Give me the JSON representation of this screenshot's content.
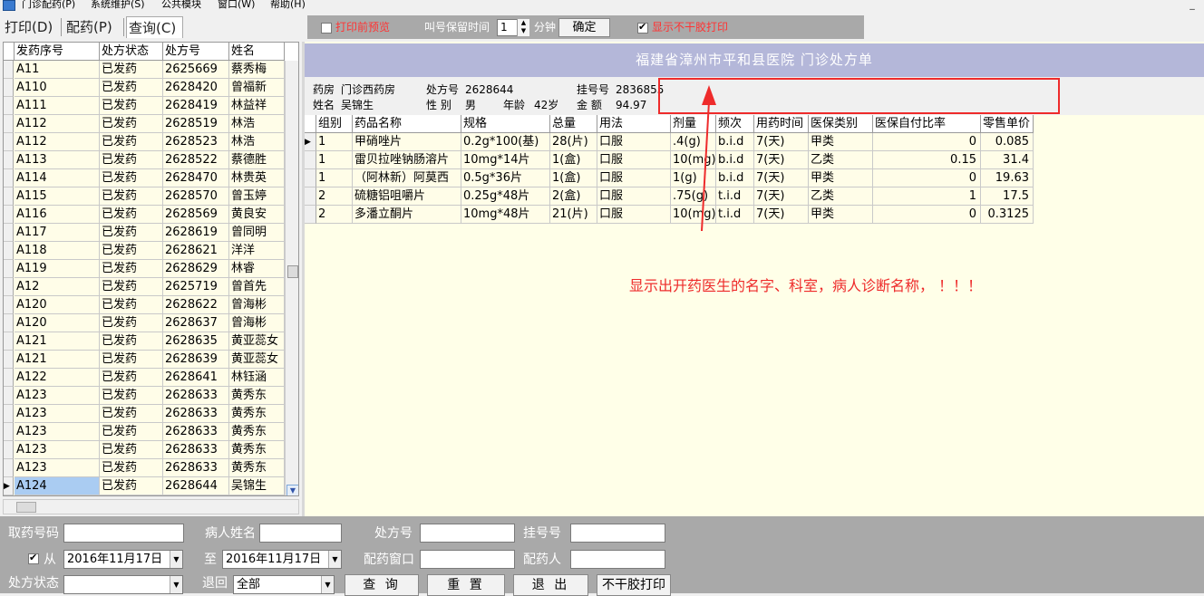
{
  "menubar": {
    "items": [
      "门诊配药(P)",
      "系统维护(S)",
      "公共模块",
      "窗口(W)",
      "帮助(H)"
    ],
    "min_glyph": "_"
  },
  "tabs": [
    {
      "label": "打印(D)",
      "active": false
    },
    {
      "label": "配药(P)",
      "active": false
    },
    {
      "label": "查询(C)",
      "active": true
    }
  ],
  "toolbar": {
    "preview_label": "打印前预览",
    "preview_checked": false,
    "hold_label": "叫号保留时间",
    "hold_value": "1",
    "minutes_label": "分钟",
    "ok_label": "确定",
    "no_dry_label": "显示不干胶打印",
    "no_dry_checked": true,
    "accent_color": "#ff3333"
  },
  "left_grid": {
    "headers": [
      "发药序号",
      "处方状态",
      "处方号",
      "姓名"
    ],
    "rows": [
      [
        "A11",
        "已发药",
        "2625669",
        "蔡秀梅"
      ],
      [
        "A110",
        "已发药",
        "2628420",
        "曾福新"
      ],
      [
        "A111",
        "已发药",
        "2628419",
        "林益祥"
      ],
      [
        "A112",
        "已发药",
        "2628519",
        "林浩"
      ],
      [
        "A112",
        "已发药",
        "2628523",
        "林浩"
      ],
      [
        "A113",
        "已发药",
        "2628522",
        "蔡德胜"
      ],
      [
        "A114",
        "已发药",
        "2628470",
        "林贵英"
      ],
      [
        "A115",
        "已发药",
        "2628570",
        "曾玉婷"
      ],
      [
        "A116",
        "已发药",
        "2628569",
        "黄良安"
      ],
      [
        "A117",
        "已发药",
        "2628619",
        "曾同明"
      ],
      [
        "A118",
        "已发药",
        "2628621",
        "洋洋"
      ],
      [
        "A119",
        "已发药",
        "2628629",
        "林睿"
      ],
      [
        "A12",
        "已发药",
        "2625719",
        "曾首先"
      ],
      [
        "A120",
        "已发药",
        "2628622",
        "曾海彬"
      ],
      [
        "A120",
        "已发药",
        "2628637",
        "曾海彬"
      ],
      [
        "A121",
        "已发药",
        "2628635",
        "黄亚蕊女"
      ],
      [
        "A121",
        "已发药",
        "2628639",
        "黄亚蕊女"
      ],
      [
        "A122",
        "已发药",
        "2628641",
        "林钰涵"
      ],
      [
        "A123",
        "已发药",
        "2628633",
        "黄秀东"
      ],
      [
        "A123",
        "已发药",
        "2628633",
        "黄秀东"
      ],
      [
        "A123",
        "已发药",
        "2628633",
        "黄秀东"
      ],
      [
        "A123",
        "已发药",
        "2628633",
        "黄秀东"
      ],
      [
        "A123",
        "已发药",
        "2628633",
        "黄秀东"
      ],
      [
        "A124",
        "已发药",
        "2628644",
        "吴锦生"
      ]
    ],
    "selected_index": 23,
    "pointer_glyph": "▶"
  },
  "prescription": {
    "title": "福建省漳州市平和县医院    门诊处方单",
    "pharmacy_label": "药房",
    "pharmacy_value": "门诊西药房",
    "rx_no_label": "处方号",
    "rx_no_value": "2628644",
    "reg_no_label": "挂号号",
    "reg_no_value": "2836855",
    "name_label": "姓名",
    "name_value": "吴锦生",
    "sex_label": "性  别",
    "sex_value": "男",
    "age_label": "年龄",
    "age_value": "42岁",
    "amount_label": "金  额",
    "amount_value": "94.97"
  },
  "rx_grid": {
    "headers": [
      "组别",
      "药品名称",
      "规格",
      "总量",
      "用法",
      "剂量",
      "频次",
      "用药时间",
      "医保类别",
      "医保自付比率",
      "零售单价"
    ],
    "rows": [
      [
        "1",
        "甲硝唑片",
        "0.2g*100(基)",
        "28(片)",
        "口服",
        ".4(g)",
        "b.i.d",
        "7(天)",
        "甲类",
        "0",
        "0.085"
      ],
      [
        "1",
        "雷贝拉唑钠肠溶片",
        "10mg*14片",
        "1(盒)",
        "口服",
        "10(mg)",
        "b.i.d",
        "7(天)",
        "乙类",
        "0.15",
        "31.4"
      ],
      [
        "1",
        "（阿林新）阿莫西",
        "0.5g*36片",
        "1(盒)",
        "口服",
        "1(g)",
        "b.i.d",
        "7(天)",
        "甲类",
        "0",
        "19.63"
      ],
      [
        "2",
        "硫糖铝咀嚼片",
        "0.25g*48片",
        "2(盒)",
        "口服",
        ".75(g)",
        "t.i.d",
        "7(天)",
        "乙类",
        "1",
        "17.5"
      ],
      [
        "2",
        "多潘立酮片",
        "10mg*48片",
        "21(片)",
        "口服",
        "10(mg)",
        "t.i.d",
        "7(天)",
        "甲类",
        "0",
        "0.3125"
      ]
    ],
    "pointer_glyph": "▶"
  },
  "annotation": {
    "text": "显示出开药医生的名字、科室，病人诊断名称，  ！！！",
    "color": "#ee2b2b"
  },
  "filters": {
    "fetch_no_label": "取药号码",
    "patient_label": "病人姓名",
    "rx_no_label": "处方号",
    "reg_no_label": "挂号号",
    "from_label": "从",
    "from_checked": true,
    "from_date": "2016年11月17日",
    "to_label": "至",
    "to_date": "2016年11月17日",
    "window_label": "配药窗口",
    "dispenser_label": "配药人",
    "status_label": "处方状态",
    "status_value": "",
    "return_label": "退回",
    "return_value": "全部",
    "query_btn": "查 询",
    "reset_btn": "重 置",
    "exit_btn": "退 出",
    "sticker_btn": "不干胶打印"
  }
}
